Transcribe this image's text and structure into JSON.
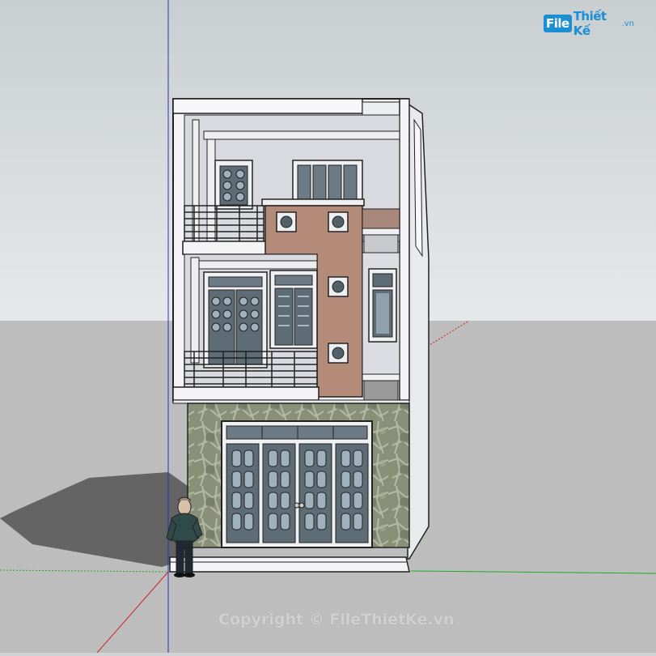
{
  "scene": {
    "sky_color": "#dadfe1",
    "ground_color": "#bdbdbd",
    "shadow_color": "#646464",
    "wall_color": "#f4f4f6",
    "accent_panel_color": "#b48a78",
    "stone_color": "#8a9078",
    "axis_colors": {
      "red": "#cc2222",
      "green": "#22aa22",
      "blue": "#2222cc"
    }
  },
  "logo": {
    "box_text": "File",
    "rest_text": "Thiết Kế",
    "suffix_text": ".vn",
    "color": "#1a8fd6"
  },
  "watermark": {
    "text": "Copyright © FileThietKe.vn"
  }
}
